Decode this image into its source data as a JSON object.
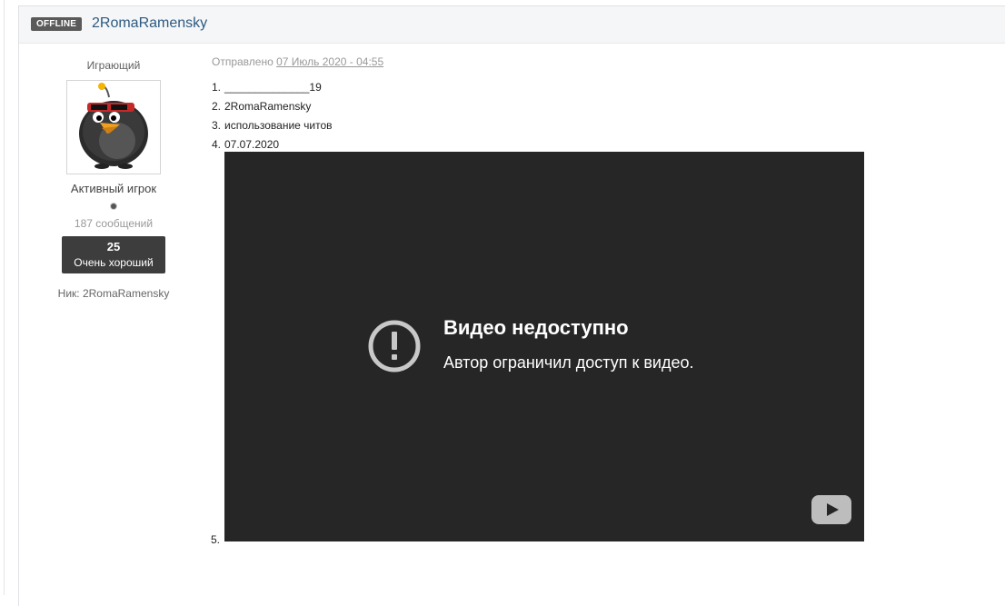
{
  "header": {
    "status_badge": "OFFLINE",
    "author_name": "2RomaRamensky"
  },
  "author": {
    "group": "Играющий",
    "rank": "Активный игрок",
    "posts": "187 сообщений",
    "reputation_value": "25",
    "reputation_label": "Очень хороший",
    "nick": "Ник: 2RomaRamensky"
  },
  "post": {
    "posted_prefix": "Отправлено",
    "posted_date": "07 Июль 2020 - 04:55",
    "items": [
      {
        "num": "1.",
        "text": "______________19"
      },
      {
        "num": "2.",
        "text": "2RomaRamensky"
      },
      {
        "num": "3.",
        "text": "использование читов"
      },
      {
        "num": "4.",
        "text": "07.07.2020"
      }
    ],
    "item5_num": "5."
  },
  "video": {
    "title": "Видео недоступно",
    "message": "Автор ограничил доступ к видео.",
    "warning_icon": "warning-icon",
    "logo_icon": "youtube-logo-icon"
  }
}
